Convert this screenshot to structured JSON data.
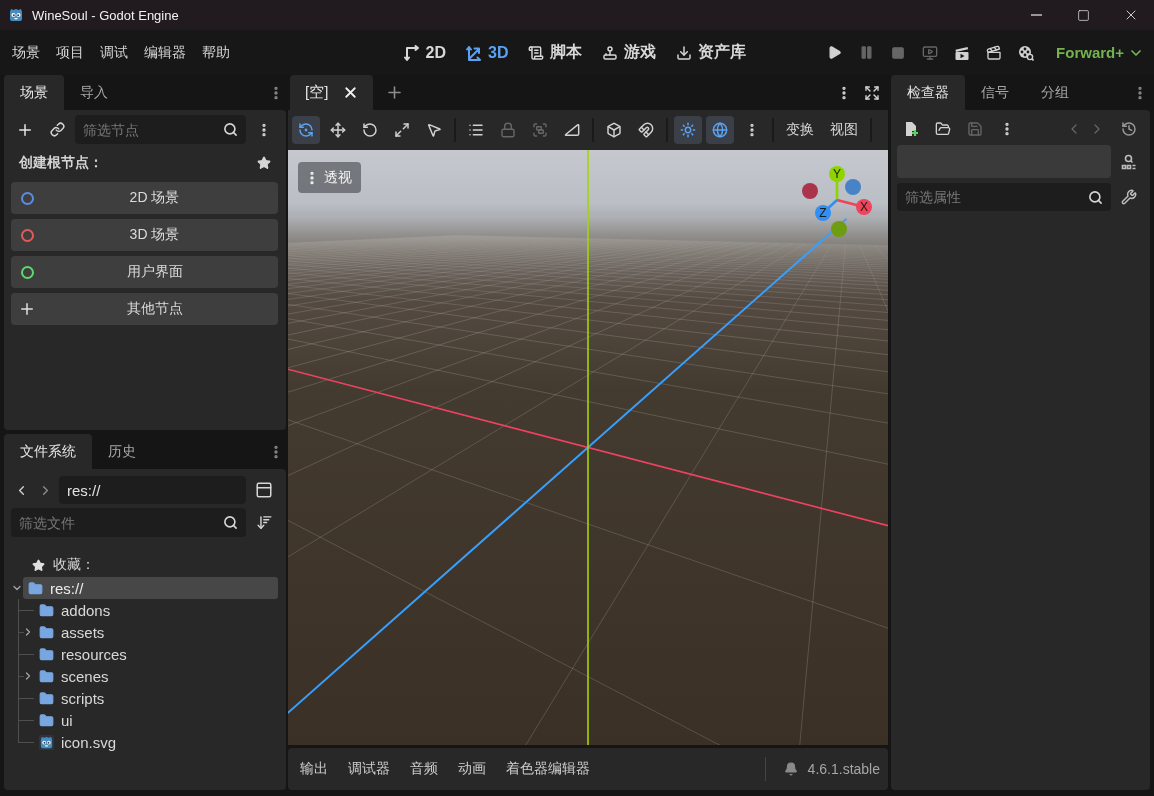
{
  "window": {
    "title": "WineSoul - Godot Engine"
  },
  "menu": [
    "场景",
    "项目",
    "调试",
    "编辑器",
    "帮助"
  ],
  "main_screens": [
    {
      "label": "2D",
      "selected": false
    },
    {
      "label": "3D",
      "selected": true
    },
    {
      "label": "脚本",
      "selected": false
    },
    {
      "label": "游戏",
      "selected": false
    },
    {
      "label": "资产库",
      "selected": false
    }
  ],
  "run_buttons": [
    {
      "disabled": false
    },
    {
      "disabled": true
    },
    {
      "disabled": true
    },
    {
      "disabled": true
    },
    {
      "disabled": false
    },
    {
      "disabled": false
    },
    {
      "disabled": false
    }
  ],
  "renderer": "Forward+",
  "scene_dock": {
    "tabs": [
      {
        "label": "场景",
        "selected": true
      },
      {
        "label": "导入",
        "selected": false
      }
    ],
    "filter": {
      "placeholder": "筛选节点"
    },
    "heading": "创建根节点：",
    "root_nodes": [
      {
        "label": "2D 场景",
        "kind": "circle",
        "color": "#5b8de6"
      },
      {
        "label": "3D 场景",
        "kind": "circle",
        "color": "#e45a5a"
      },
      {
        "label": "用户界面",
        "kind": "circle",
        "color": "#5fd86a"
      },
      {
        "label": "其他节点",
        "kind": "plus"
      }
    ]
  },
  "filesystem_dock": {
    "tabs": [
      {
        "label": "文件系统",
        "selected": true
      },
      {
        "label": "历史",
        "selected": false
      }
    ],
    "path": "res://",
    "filter": {
      "placeholder": "筛选文件"
    },
    "favorites": "收藏：",
    "tree": {
      "label": "res://",
      "selected": true,
      "expanded": true,
      "children": [
        {
          "label": "addons",
          "kind": "folder",
          "has_children": false,
          "expanded": false,
          "selected": false
        },
        {
          "label": "assets",
          "kind": "folder",
          "has_children": true,
          "expanded": false,
          "selected": false
        },
        {
          "label": "resources",
          "kind": "folder",
          "has_children": false,
          "expanded": false,
          "selected": false
        },
        {
          "label": "scenes",
          "kind": "folder",
          "has_children": true,
          "expanded": false,
          "selected": false
        },
        {
          "label": "scripts",
          "kind": "folder",
          "has_children": false,
          "expanded": false,
          "selected": false
        },
        {
          "label": "ui",
          "kind": "folder",
          "has_children": false,
          "expanded": false,
          "selected": false
        },
        {
          "label": "icon.svg",
          "kind": "file",
          "has_children": false,
          "expanded": false,
          "selected": false
        }
      ]
    }
  },
  "viewport": {
    "tabs": [
      {
        "label": "[空]",
        "selected": true
      }
    ],
    "transform_tools": [
      {
        "selected": true
      },
      {
        "selected": false
      },
      {
        "selected": false
      },
      {
        "selected": false
      },
      {
        "selected": false
      }
    ],
    "edit_tools": [
      {
        "disabled": false
      },
      {
        "disabled": true
      },
      {
        "disabled": true
      },
      {
        "disabled": false
      }
    ],
    "toggles": [
      {
        "on": false
      },
      {
        "on": false
      },
      {
        "on": true
      },
      {
        "on": true
      }
    ],
    "menus": [
      "变换",
      "视图"
    ],
    "view_button": "透视",
    "gizmo": [
      {
        "label": "Y",
        "color": "#8fd400"
      },
      {
        "label": "X",
        "color": "#f0445a"
      },
      {
        "label": "Z",
        "color": "#2f8ff5"
      }
    ]
  },
  "bottom_panel": {
    "tabs": [
      {
        "label": "输出",
        "selected": false
      },
      {
        "label": "调试器",
        "selected": false
      },
      {
        "label": "音频",
        "selected": false
      },
      {
        "label": "动画",
        "selected": false
      },
      {
        "label": "着色器编辑器",
        "selected": false
      }
    ],
    "version": "4.6.1.stable"
  },
  "inspector_dock": {
    "tabs": [
      {
        "label": "检查器",
        "selected": true
      },
      {
        "label": "信号",
        "selected": false
      },
      {
        "label": "分组",
        "selected": false
      }
    ],
    "tools": [
      {
        "disabled": false
      },
      {
        "disabled": false
      },
      {
        "disabled": true
      }
    ],
    "history": [
      {
        "disabled": true
      },
      {
        "disabled": true
      }
    ],
    "filter": {
      "placeholder": "筛选属性"
    }
  }
}
